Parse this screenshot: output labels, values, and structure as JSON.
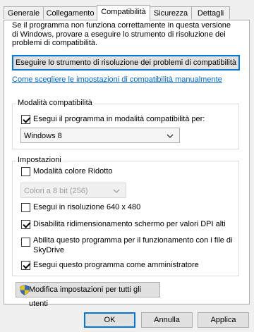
{
  "tabs": [
    {
      "label": "Generale"
    },
    {
      "label": "Collegamento"
    },
    {
      "label": "Compatibilità"
    },
    {
      "label": "Sicurezza"
    },
    {
      "label": "Dettagli"
    }
  ],
  "intro_text": "Se il programma non funziona correttamente in questa versione di Windows, provare a eseguire lo strumento di risoluzione dei problemi di compatibilità.",
  "troubleshooter_button": "Eseguire lo strumento di risoluzione dei problemi di compatibilità",
  "manual_link": "Come scegliere le impostazioni di compatibilità manualmente",
  "compat_mode": {
    "legend": "Modalità compatibilità",
    "checkbox_label": "Esegui il programma in modalità compatibilità per:",
    "checked": true,
    "selected_os": "Windows 8"
  },
  "settings": {
    "legend": "Impostazioni",
    "reduced_color": {
      "label": "Modalità colore Ridotto",
      "checked": false
    },
    "color_depth": "Colori a 8 bit (256)",
    "res640": {
      "label": "Esegui in risoluzione 640 x 480",
      "checked": false
    },
    "dpi": {
      "label": "Disabilita ridimensionamento schermo per valori DPI alti",
      "checked": true
    },
    "skydrive": {
      "label_line1": "Abilita questo programma per il funzionamento con i file di",
      "label_line2": "SkyDrive",
      "checked": false
    },
    "admin": {
      "label": "Esegui questo programma come amministratore",
      "checked": true
    }
  },
  "all_users_button": "Modifica impostazioni per tutti gli utenti",
  "footer": {
    "ok": "OK",
    "cancel": "Annulla",
    "apply": "Applica"
  }
}
